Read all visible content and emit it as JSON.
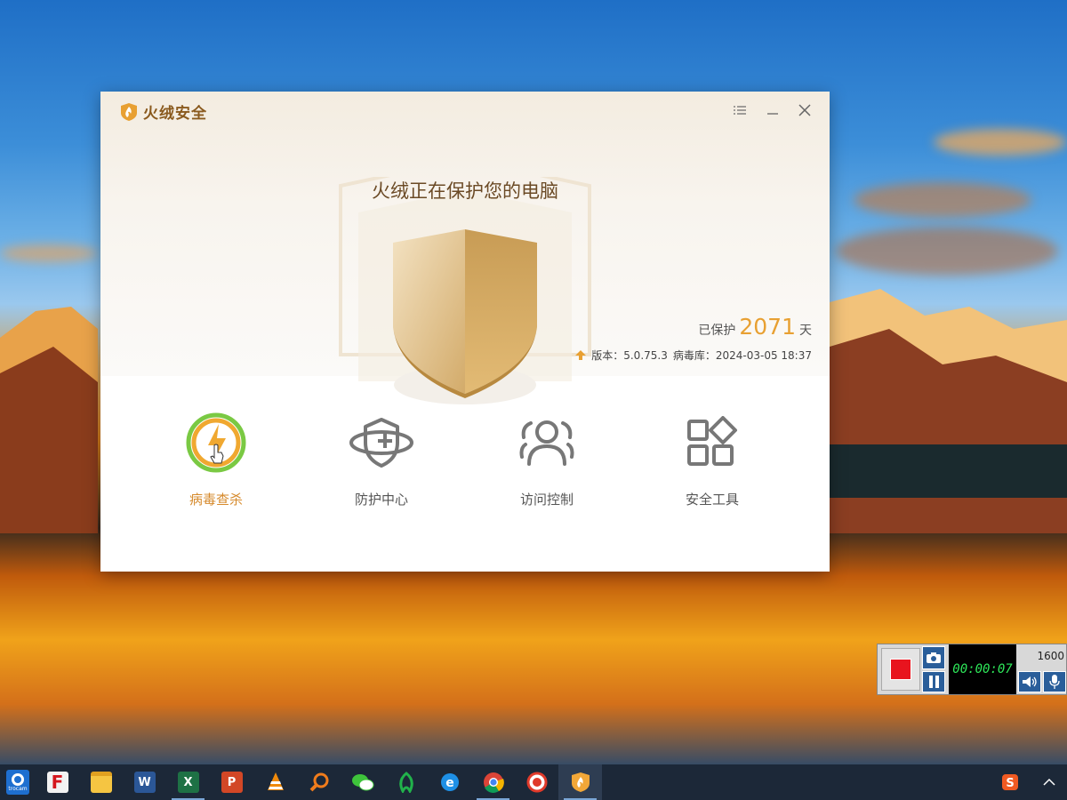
{
  "app": {
    "title": "火绒安全",
    "headline": "火绒正在保护您的电脑",
    "protected_prefix": "已保护",
    "protected_days": "2071",
    "protected_suffix": "天",
    "version_label": "版本：5.0.75.3",
    "virusdb_label": "病毒库：2024-03-05 18:37",
    "accent_color": "#e8a032"
  },
  "window_controls": {
    "menu_icon": "menu-list-icon",
    "minimize_icon": "minimize-icon",
    "close_icon": "close-icon"
  },
  "nav": [
    {
      "label": "病毒查杀",
      "icon": "virus-scan-icon",
      "active": true
    },
    {
      "label": "防护中心",
      "icon": "protection-shield-icon",
      "active": false
    },
    {
      "label": "访问控制",
      "icon": "users-icon",
      "active": false
    },
    {
      "label": "安全工具",
      "icon": "tools-grid-icon",
      "active": false
    }
  ],
  "recorder": {
    "timer": "00:00:07",
    "resolution": "1600"
  },
  "taskbar": {
    "start_label": "trocam",
    "apps": [
      "F",
      "explorer",
      "W",
      "X",
      "P",
      "vlc",
      "search",
      "wechat",
      "green-app",
      "ie",
      "chrome",
      "record-app",
      "huorong"
    ]
  }
}
